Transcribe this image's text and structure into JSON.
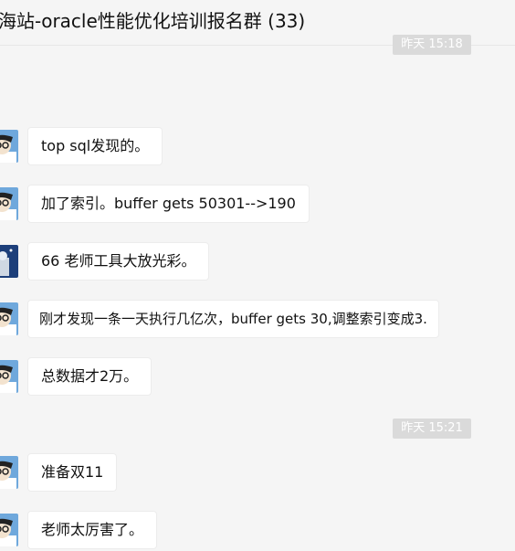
{
  "header": {
    "title": "海站-oracle性能优化培训报名群 (33)"
  },
  "timestamps": {
    "top": "昨天 15:18",
    "middle": "昨天 15:21"
  },
  "messages": [
    {
      "avatar": "cartoon-boy-avatar",
      "text": "top sql发现的。"
    },
    {
      "avatar": "cartoon-boy-avatar",
      "text": "加了索引。buffer gets 50301-->190"
    },
    {
      "avatar": "photo-avatar",
      "text": "66 老师工具大放光彩。"
    },
    {
      "avatar": "cartoon-boy-avatar",
      "text": "刚才发现一条一天执行几亿次，buffer gets 30,调整索引变成3."
    },
    {
      "avatar": "cartoon-boy-avatar",
      "text": "总数据才2万。"
    },
    {
      "avatar": "cartoon-boy-avatar",
      "text": "准备双11"
    },
    {
      "avatar": "cartoon-boy-avatar",
      "text": "老师太厉害了。"
    }
  ],
  "colors": {
    "background": "#f5f5f5",
    "bubble": "#ffffff",
    "timestamp_bg": "#dadada"
  }
}
